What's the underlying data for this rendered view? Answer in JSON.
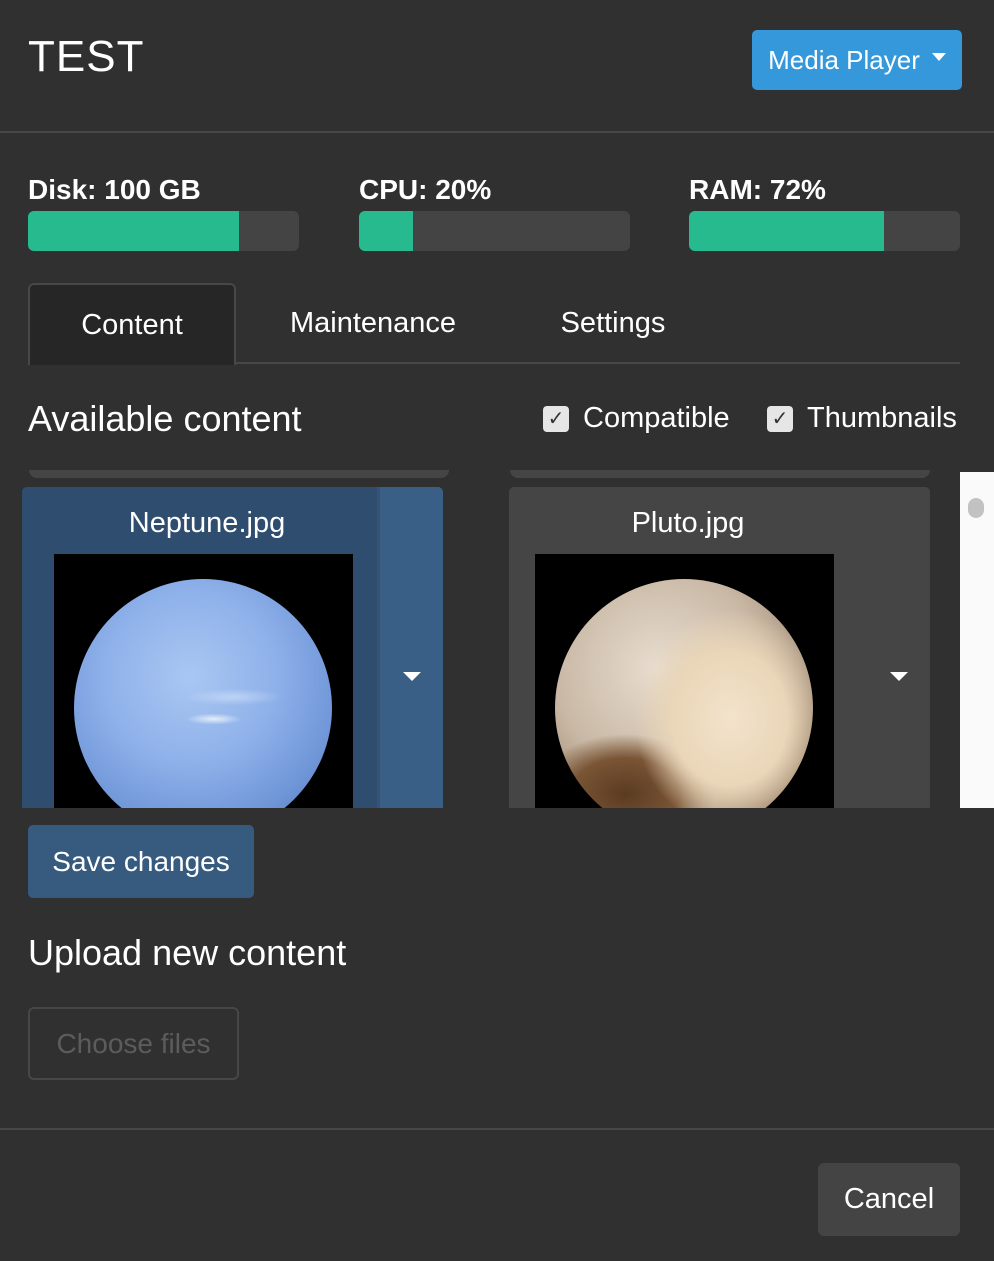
{
  "header": {
    "title": "TEST",
    "menu_button_label": "Media Player"
  },
  "stats": {
    "disk": {
      "label": "Disk: 100 GB",
      "fraction": 0.78
    },
    "cpu": {
      "label": "CPU: 20%",
      "fraction": 0.2
    },
    "ram": {
      "label": "RAM: 72%",
      "fraction": 0.72
    }
  },
  "tabs": [
    {
      "label": "Content",
      "active": true
    },
    {
      "label": "Maintenance",
      "active": false
    },
    {
      "label": "Settings",
      "active": false
    }
  ],
  "available": {
    "title": "Available content",
    "compatible_label": "Compatible",
    "compatible_checked": true,
    "thumbnails_label": "Thumbnails",
    "thumbnails_checked": true,
    "items": [
      {
        "name": "Neptune.jpg",
        "selected": true
      },
      {
        "name": "Pluto.jpg",
        "selected": false
      }
    ]
  },
  "save_label": "Save changes",
  "upload": {
    "title": "Upload new content",
    "choose_label": "Choose files"
  },
  "footer": {
    "cancel_label": "Cancel"
  },
  "colors": {
    "accent": "#3498db",
    "progress": "#26ba8e",
    "primary_dark": "#375a7f",
    "background": "#303030"
  }
}
